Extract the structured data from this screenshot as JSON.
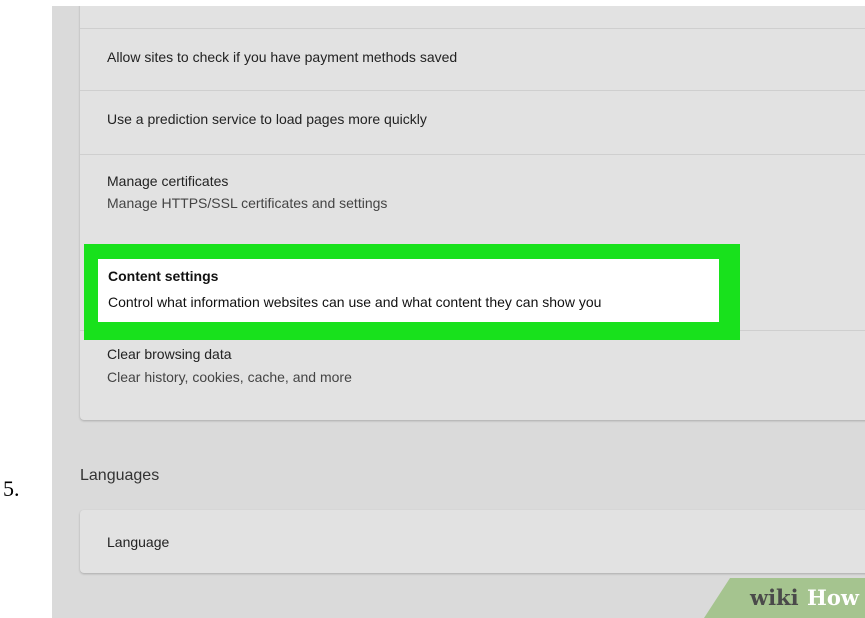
{
  "step_number": "5.",
  "privacy_section": {
    "cut_off_text": "",
    "rows": [
      {
        "title": "Allow sites to check if you have payment methods saved"
      },
      {
        "title": "Use a prediction service to load pages more quickly"
      },
      {
        "title": "Manage certificates",
        "subtitle": "Manage HTTPS/SSL certificates and settings"
      },
      {
        "title": "Content settings",
        "subtitle": "Control what information websites can use and what content they can show you"
      },
      {
        "title": "Clear browsing data",
        "subtitle": "Clear history, cookies, cache, and more"
      }
    ]
  },
  "languages_section": {
    "heading": "Languages",
    "rows": [
      {
        "title": "Language"
      }
    ]
  },
  "watermark": {
    "part1": "wiki",
    "part2": "How"
  },
  "colors": {
    "highlight": "#18e11c",
    "panel_background": "#dadada",
    "card_background": "#e2e2e2",
    "watermark": "#a5c48f"
  }
}
